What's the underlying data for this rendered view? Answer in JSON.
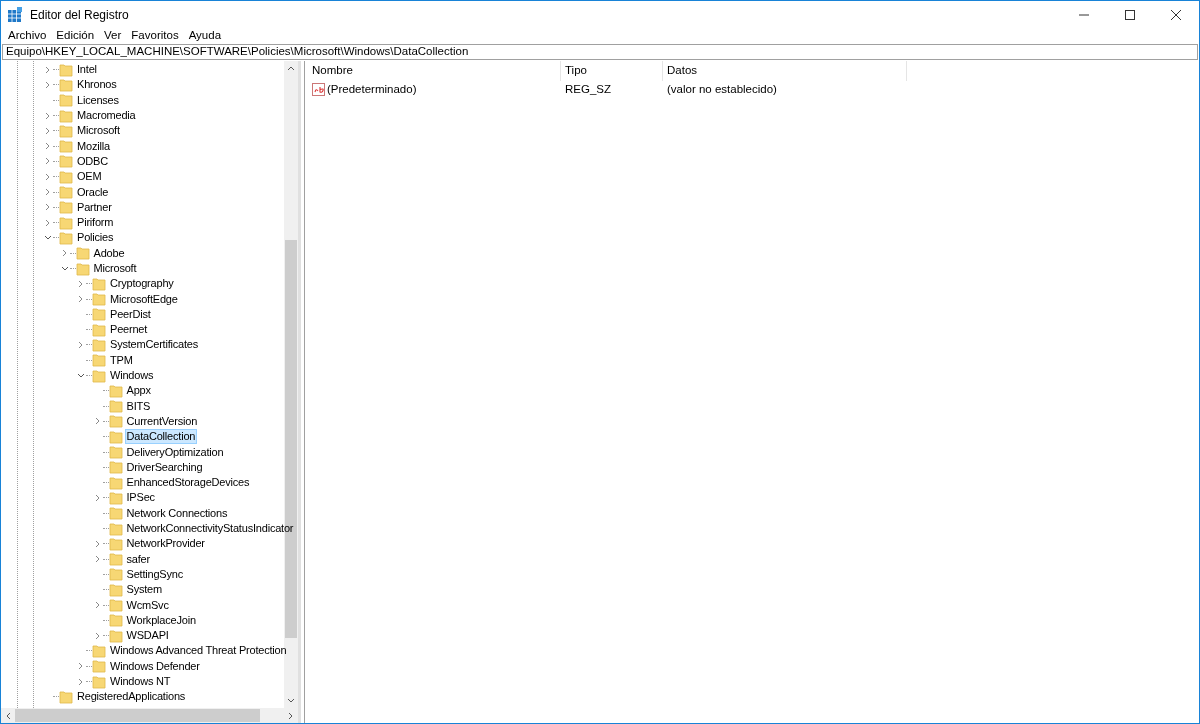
{
  "window": {
    "title": "Editor del Registro"
  },
  "menu": [
    "Archivo",
    "Edición",
    "Ver",
    "Favoritos",
    "Ayuda"
  ],
  "address": "Equipo\\HKEY_LOCAL_MACHINE\\SOFTWARE\\Policies\\Microsoft\\Windows\\DataCollection",
  "tree": [
    {
      "label": "Intel",
      "expanded": false,
      "selected": false
    },
    {
      "label": "Khronos",
      "expanded": false,
      "selected": false
    },
    {
      "label": "Licenses",
      "selected": false
    },
    {
      "label": "Macromedia",
      "expanded": false,
      "selected": false
    },
    {
      "label": "Microsoft",
      "expanded": false,
      "selected": false
    },
    {
      "label": "Mozilla",
      "expanded": false,
      "selected": false
    },
    {
      "label": "ODBC",
      "expanded": false,
      "selected": false
    },
    {
      "label": "OEM",
      "expanded": false,
      "selected": false
    },
    {
      "label": "Oracle",
      "expanded": false,
      "selected": false
    },
    {
      "label": "Partner",
      "expanded": false,
      "selected": false
    },
    {
      "label": "Piriform",
      "expanded": false,
      "selected": false
    },
    {
      "label": "Policies",
      "expanded": true,
      "selected": false,
      "children": [
        {
          "label": "Adobe",
          "expanded": false,
          "selected": false
        },
        {
          "label": "Microsoft",
          "expanded": true,
          "selected": false,
          "children": [
            {
              "label": "Cryptography",
              "expanded": false,
              "selected": false
            },
            {
              "label": "MicrosoftEdge",
              "expanded": false,
              "selected": false
            },
            {
              "label": "PeerDist",
              "selected": false
            },
            {
              "label": "Peernet",
              "selected": false
            },
            {
              "label": "SystemCertificates",
              "expanded": false,
              "selected": false
            },
            {
              "label": "TPM",
              "selected": false
            },
            {
              "label": "Windows",
              "expanded": true,
              "selected": false,
              "children": [
                {
                  "label": "Appx",
                  "selected": false
                },
                {
                  "label": "BITS",
                  "selected": false
                },
                {
                  "label": "CurrentVersion",
                  "expanded": false,
                  "selected": false
                },
                {
                  "label": "DataCollection",
                  "selected": true
                },
                {
                  "label": "DeliveryOptimization",
                  "selected": false
                },
                {
                  "label": "DriverSearching",
                  "selected": false
                },
                {
                  "label": "EnhancedStorageDevices",
                  "selected": false
                },
                {
                  "label": "IPSec",
                  "expanded": false,
                  "selected": false
                },
                {
                  "label": "Network Connections",
                  "selected": false
                },
                {
                  "label": "NetworkConnectivityStatusIndicator",
                  "selected": false
                },
                {
                  "label": "NetworkProvider",
                  "expanded": false,
                  "selected": false
                },
                {
                  "label": "safer",
                  "expanded": false,
                  "selected": false
                },
                {
                  "label": "SettingSync",
                  "selected": false
                },
                {
                  "label": "System",
                  "selected": false
                },
                {
                  "label": "WcmSvc",
                  "expanded": false,
                  "selected": false
                },
                {
                  "label": "WorkplaceJoin",
                  "selected": false
                },
                {
                  "label": "WSDAPI",
                  "expanded": false,
                  "selected": false
                }
              ]
            },
            {
              "label": "Windows Advanced Threat Protection",
              "selected": false
            },
            {
              "label": "Windows Defender",
              "expanded": false,
              "selected": false
            },
            {
              "label": "Windows NT",
              "expanded": false,
              "selected": false
            }
          ]
        }
      ]
    },
    {
      "label": "RegisteredApplications",
      "selected": false
    }
  ],
  "columns": [
    "Nombre",
    "Tipo",
    "Datos"
  ],
  "values": [
    {
      "name": "(Predeterminado)",
      "type": "REG_SZ",
      "data": "(valor no establecido)"
    }
  ]
}
